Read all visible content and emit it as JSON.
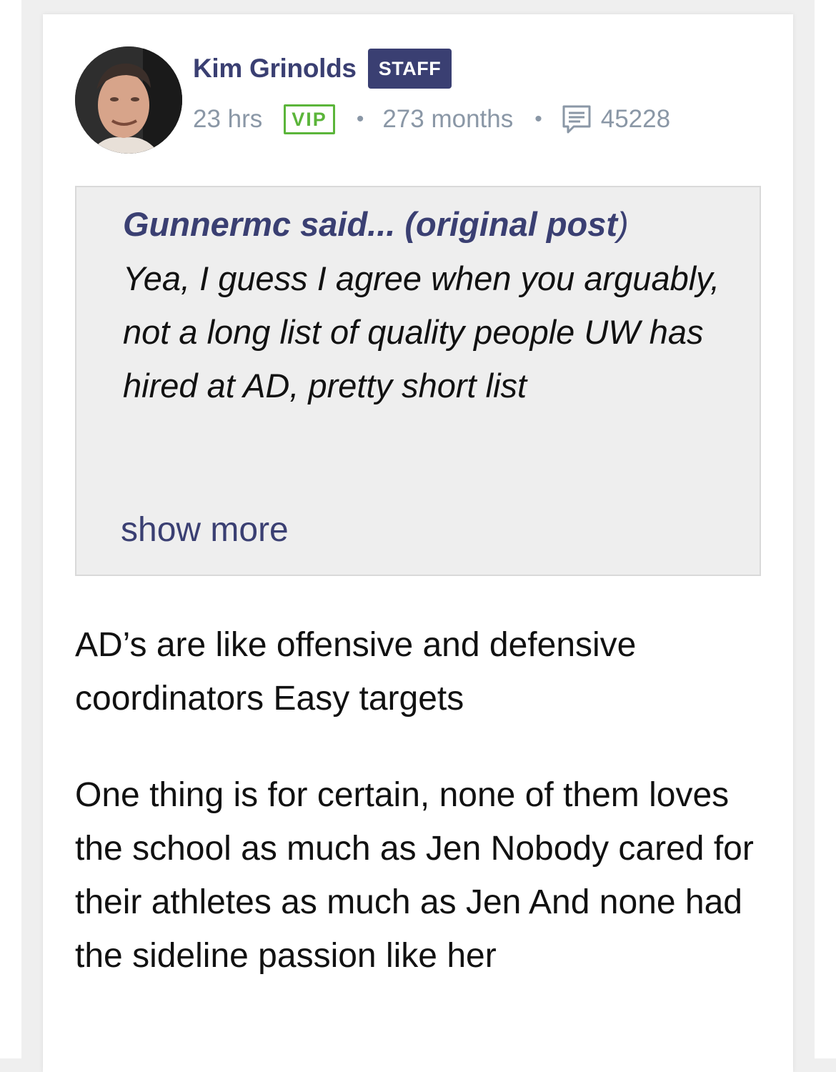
{
  "author": {
    "name": "Kim Grinolds",
    "badge": "STAFF",
    "avatar_alt": "avatar"
  },
  "meta": {
    "time": "23 hrs",
    "vip": "VIP",
    "tenure": "273 months",
    "separator": "•",
    "post_count": "45228",
    "icon": "comment-icon"
  },
  "quote": {
    "author": "Gunnermc",
    "said": " said... (",
    "link": "original post",
    "close": ")",
    "text": "Yea, I guess I agree when you arguably, not a long list of quality people UW has hired at AD, pretty short list",
    "show_more": "show more"
  },
  "post": {
    "paragraph_1": "AD’s are like offensive and defensive coordinators Easy targets",
    "paragraph_2": "One thing is for certain, none of them loves the school as much as Jen Nobody cared for their athletes as much as Jen And none had the sideline passion like her"
  },
  "colors": {
    "brand": "#3a3f72",
    "vip": "#5bb53a",
    "meta": "#8a97a6",
    "quote_bg": "#eeeeee"
  }
}
